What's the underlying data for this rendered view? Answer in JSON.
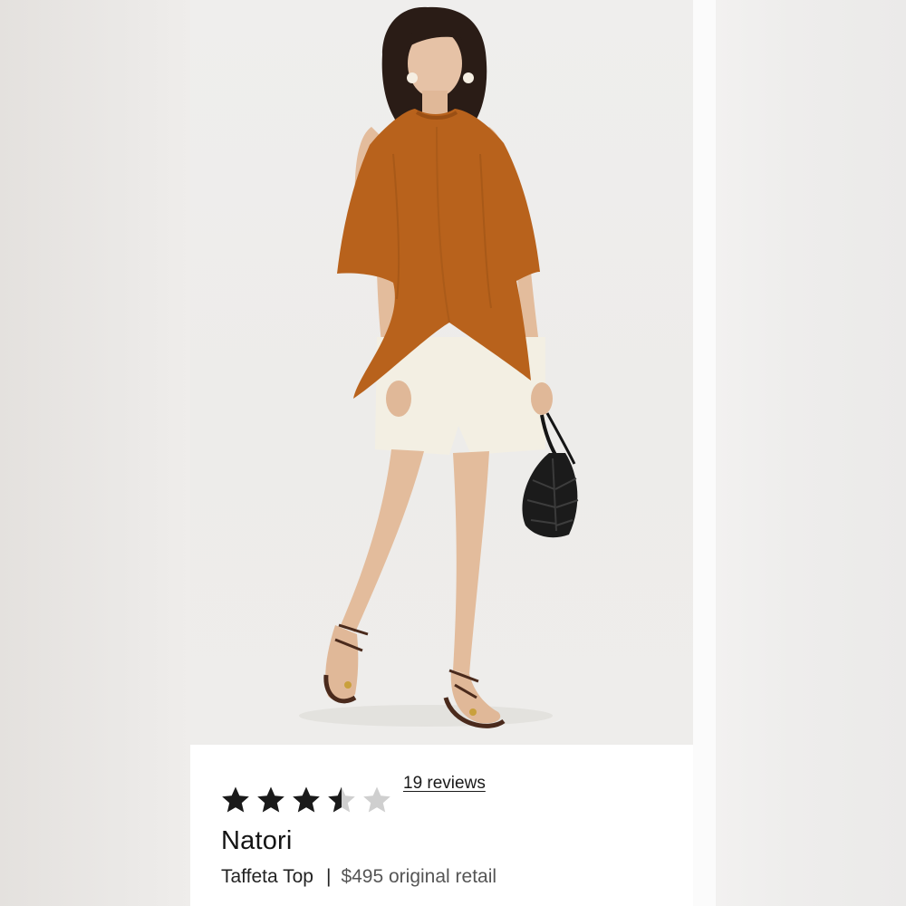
{
  "product": {
    "rating": 3.5,
    "rating_max": 5,
    "reviews_label": "19 reviews",
    "brand": "Natori",
    "name": "Taffeta Top",
    "separator": "|",
    "price": "$495 original retail"
  },
  "colors": {
    "star_filled": "#1a1a1a",
    "star_empty": "#cfcfcf",
    "top": "#b8621c",
    "shorts": "#f3efe3"
  },
  "icons": {
    "star": "star-icon",
    "bag": "leaf-handbag"
  }
}
